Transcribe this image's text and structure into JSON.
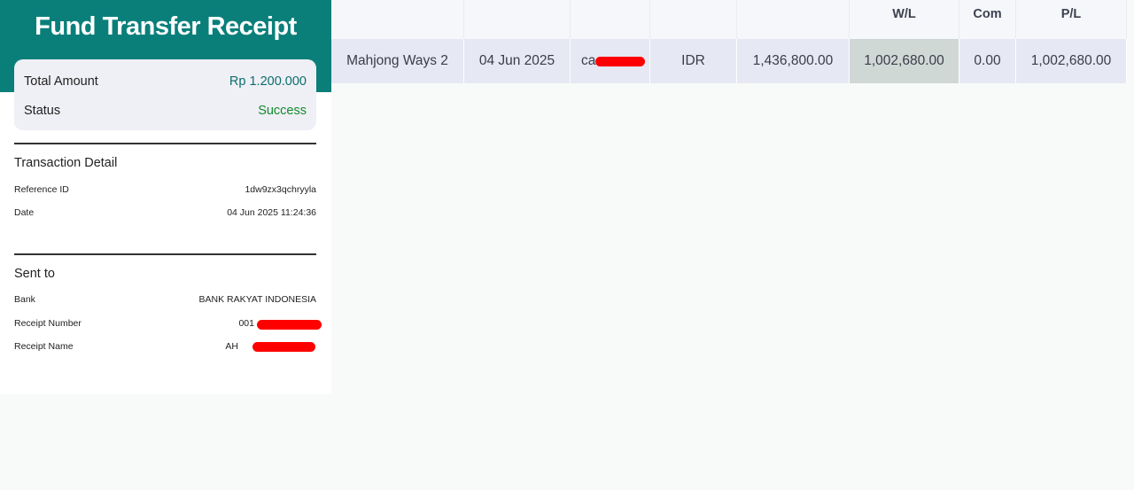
{
  "receipt": {
    "title": "Fund Transfer Receipt",
    "total_amount_label": "Total Amount",
    "total_amount_value": "Rp 1.200.000",
    "status_label": "Status",
    "status_value": "Success",
    "transaction_detail": {
      "heading": "Transaction Detail",
      "reference_label": "Reference ID",
      "reference_value": "1dw9zx3qchryyla",
      "date_label": "Date",
      "date_value": "04 Jun 2025 11:24:36"
    },
    "sent_to": {
      "heading": "Sent to",
      "bank_label": "Bank",
      "bank_value": "BANK RAKYAT INDONESIA",
      "receipt_number_label": "Receipt Number",
      "receipt_number_visible": "001",
      "receipt_name_label": "Receipt Name",
      "receipt_name_visible": "AH"
    }
  },
  "table": {
    "headers": [
      "",
      "",
      "",
      "",
      "",
      "W/L",
      "Com",
      "P/L"
    ],
    "row": {
      "game": "Mahjong Ways 2",
      "date": "04 Jun 2025",
      "user_visible": "ca",
      "currency": "IDR",
      "bet": "1,436,800.00",
      "wl": "1,002,680.00",
      "com": "0.00",
      "pl": "1,002,680.00"
    }
  },
  "colors": {
    "brand_teal": "#0a7f7a",
    "success_green": "#128b2a",
    "redaction": "#ff0000",
    "row_bg": "#e6e8f3",
    "highlight_cell": "#cfd8d5"
  }
}
